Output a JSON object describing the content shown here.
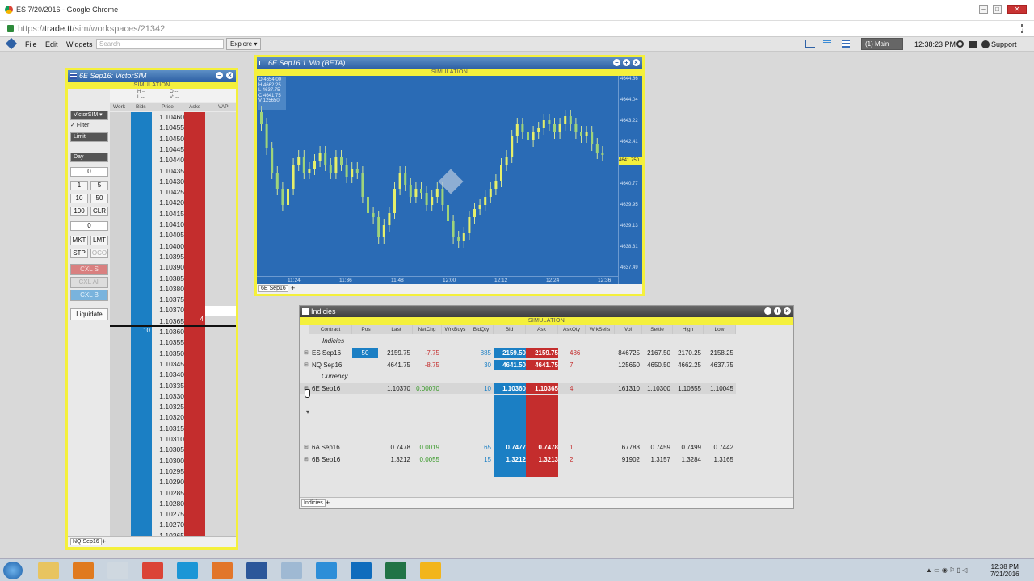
{
  "window": {
    "title": "ES 7/20/2016 - Google Chrome",
    "controls": [
      "–",
      "□",
      "✕"
    ]
  },
  "address": {
    "scheme": "https://",
    "host": "trade.tt",
    "path": "/sim/workspaces/21342"
  },
  "menu": {
    "file": "File",
    "edit": "Edit",
    "widgets": "Widgets",
    "search_placeholder": "Search",
    "explore": "Explore ▾"
  },
  "toolbar": {
    "workspace": "(1) Main",
    "time": "12:38:23 PM",
    "support": "Support"
  },
  "ladder": {
    "title": "6E Sep16: VictorSIM",
    "sim": "SIMULATION",
    "header_small": [
      "H --",
      "L --",
      "O --",
      "V: --"
    ],
    "columns": [
      "Work",
      "Bids",
      "Price",
      "Asks",
      "VAP"
    ],
    "account": "VictorSIM ▾",
    "filter": "Filter",
    "order_type": "Limit",
    "tif": "Day",
    "qty1": "0",
    "q_buttons": [
      "1",
      "5",
      "10",
      "50",
      "100",
      "CLR"
    ],
    "qty2": "0",
    "btn_mkt": "MKT",
    "btn_lmt": "LMT",
    "btn_stp": "STP",
    "btn_oco": "OCO",
    "cxl_s": "CXL S",
    "cxl_all": "CXL All",
    "cxl_b": "CXL B",
    "liquidate": "Liquidate",
    "prices": [
      "1.10460",
      "1.10455",
      "1.10450",
      "1.10445",
      "1.10440",
      "1.10435",
      "1.10430",
      "1.10425",
      "1.10420",
      "1.10415",
      "1.10410",
      "1.10405",
      "1.10400",
      "1.10395",
      "1.10390",
      "1.10385",
      "1.10380",
      "1.10375",
      "1.10370",
      "1.10365",
      "1.10360",
      "1.10355",
      "1.10350",
      "1.10345",
      "1.10340",
      "1.10335",
      "1.10330",
      "1.10325",
      "1.10320",
      "1.10315",
      "1.10310",
      "1.10305",
      "1.10300",
      "1.10295",
      "1.10290",
      "1.10285",
      "1.10280",
      "1.10275",
      "1.10270",
      "1.10265"
    ],
    "ask_qty": "4",
    "bid_qty": "10",
    "tab": "NQ Sep16",
    "colors": {
      "bids": "#1b7fc4",
      "asks": "#c42d2d"
    }
  },
  "chart": {
    "title": "6E Sep16 1 Min (BETA)",
    "sim": "SIMULATION",
    "ohlc": [
      "O 4654.00",
      "H 4662.25",
      "L 4637.75",
      "C 4641.75",
      "",
      "V 125650"
    ],
    "price_labels": [
      "4644.86",
      "4644.04",
      "4643.22",
      "4642.41",
      "4641.59",
      "4640.77",
      "4639.95",
      "4639.13",
      "4638.31",
      "4637.49"
    ],
    "current_price": "4641.750",
    "times": [
      "11:24",
      "11:36",
      "11:48",
      "12:00",
      "12:12",
      "12:24",
      "12:36"
    ],
    "tab": "6E Sep16",
    "colors": {
      "bg": "#2a6bb5",
      "up": "#e6ef6a",
      "down": "#c8e98b"
    }
  },
  "indicies": {
    "title": "Indicies",
    "sim": "SIMULATION",
    "columns": [
      "Contract",
      "Pos",
      "Last",
      "NetChg",
      "WrkBuys",
      "BidQty",
      "Bid",
      "Ask",
      "AskQty",
      "WrkSells",
      "Vol",
      "Settle",
      "High",
      "Low"
    ],
    "group1": "Indicies",
    "group2": "Currency",
    "rows": [
      {
        "contract": "ES Sep16",
        "pos": "50",
        "last": "2159.75",
        "netchg": "-7.75",
        "bidqty": "885",
        "bid": "2159.50",
        "ask": "2159.75",
        "askqty": "486",
        "vol": "846725",
        "settle": "2167.50",
        "high": "2170.25",
        "low": "2158.25"
      },
      {
        "contract": "NQ Sep16",
        "pos": "",
        "last": "4641.75",
        "netchg": "-8.75",
        "bidqty": "30",
        "bid": "4641.50",
        "ask": "4641.75",
        "askqty": "7",
        "vol": "125650",
        "settle": "4650.50",
        "high": "4662.25",
        "low": "4637.75"
      },
      {
        "contract": "6E Sep16",
        "pos": "",
        "last": "1.10370",
        "netchg": "0.00070",
        "bidqty": "10",
        "bid": "1.10360",
        "ask": "1.10365",
        "askqty": "4",
        "vol": "161310",
        "settle": "1.10300",
        "high": "1.10855",
        "low": "1.10045"
      },
      {
        "contract": "6A Sep16",
        "pos": "",
        "last": "0.7478",
        "netchg": "0.0019",
        "bidqty": "65",
        "bid": "0.7477",
        "ask": "0.7478",
        "askqty": "1",
        "vol": "67783",
        "settle": "0.7459",
        "high": "0.7499",
        "low": "0.7442"
      },
      {
        "contract": "6B Sep16",
        "pos": "",
        "last": "1.3212",
        "netchg": "0.0055",
        "bidqty": "15",
        "bid": "1.3212",
        "ask": "1.3213",
        "askqty": "2",
        "vol": "91902",
        "settle": "1.3157",
        "high": "1.3284",
        "low": "1.3165"
      }
    ],
    "tab": "Indicies"
  },
  "taskbar": {
    "time": "12:38 PM",
    "date": "7/21/2016",
    "apps": [
      "start-icon",
      "explorer-icon",
      "media-player-icon",
      "files-icon",
      "chrome-icon",
      "skype-icon",
      "b-app-icon",
      "word-icon",
      "app-icon",
      "ie-icon",
      "outlook-icon",
      "excel-icon",
      "settings-app-icon"
    ]
  }
}
